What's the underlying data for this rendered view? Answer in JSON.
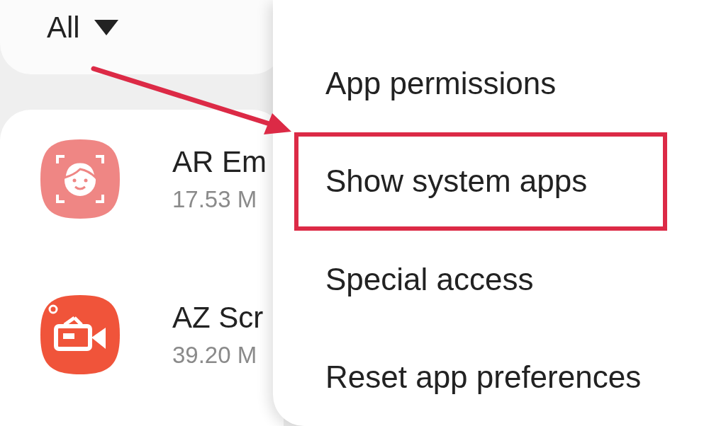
{
  "filter": {
    "label": "All"
  },
  "apps": [
    {
      "name": "AR Em",
      "size": "17.53 M",
      "kind": "face"
    },
    {
      "name": "AZ Scr",
      "size": "39.20 M",
      "kind": "camera"
    }
  ],
  "menu": {
    "items": [
      {
        "label": "App permissions",
        "highlighted": false
      },
      {
        "label": "Show system apps",
        "highlighted": true
      },
      {
        "label": "Special access",
        "highlighted": false
      },
      {
        "label": "Reset app preferences",
        "highlighted": false
      }
    ]
  },
  "annotation_arrow": true
}
